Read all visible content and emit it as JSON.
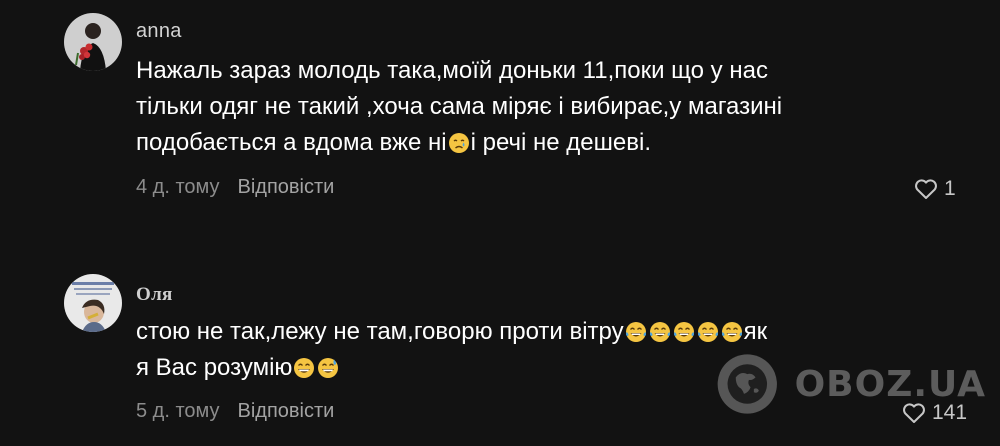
{
  "comments": [
    {
      "author": "anna",
      "text_lines": [
        "Нажаль зараз молодь така,моїй доньки 11,поки що у нас",
        "тільки одяг не такий ,хоча сама міряє і вибирає,у магазині"
      ],
      "line3_before_emoji": "подобається а вдома вже ні",
      "line3_after_emoji": "і речі не дешеві.",
      "time": "4 д. тому",
      "reply_label": "Відповісти",
      "likes": "1"
    },
    {
      "author": "Оля",
      "line1_before_emoji": "стою не так,лежу не там,говорю проти вітру",
      "line1_after_emoji": "як",
      "line2": "я Вас розумію",
      "time": "5 д. тому",
      "reply_label": "Відповісти",
      "likes": "141"
    }
  ],
  "icons": {
    "like": "heart-outline-icon",
    "crying_emoji": "crying-face-emoji",
    "laughing_emoji": "tears-of-joy-emoji",
    "grin_emoji": "grinning-face-emoji",
    "sweat_emoji": "grinning-sweat-emoji",
    "watermark": "globe-logo-icon"
  },
  "watermark": {
    "text": "OBOZ.UA"
  },
  "colors": {
    "background": "#121212",
    "text": "#ffffff",
    "meta": "#8c8c8c",
    "author": "#d3d3d3"
  }
}
